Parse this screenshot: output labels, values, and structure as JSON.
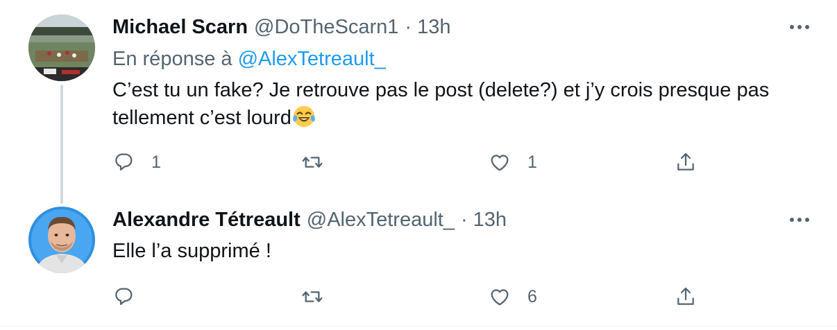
{
  "tweets": [
    {
      "name": "Michael Scarn",
      "handle": "@DoTheScarn1",
      "dot": "·",
      "time": "13h",
      "reply_prefix": "En réponse à",
      "reply_mention": "@AlexTetreault_",
      "text_line1": "C’est tu un fake? Je retrouve pas le post (delete?) et j’y crois presque pas",
      "text_line2": "tellement c’est lourd",
      "emoji": "face-with-tears-of-joy",
      "reply_count": "1",
      "retweet_count": "",
      "like_count": "1"
    },
    {
      "name": "Alexandre Tétreault",
      "handle": "@AlexTetreault_",
      "dot": "·",
      "time": "13h",
      "text_line1": "Elle l’a supprimé !",
      "reply_count": "",
      "retweet_count": "",
      "like_count": "6"
    }
  ],
  "colors": {
    "text_primary": "#0f1419",
    "text_secondary": "#536471",
    "link": "#1d9bf0",
    "thread_line": "#cfd9de"
  },
  "icons": {
    "more": "more-horizontal-icon",
    "reply": "reply-icon",
    "retweet": "retweet-icon",
    "like": "heart-icon",
    "share": "share-icon"
  }
}
